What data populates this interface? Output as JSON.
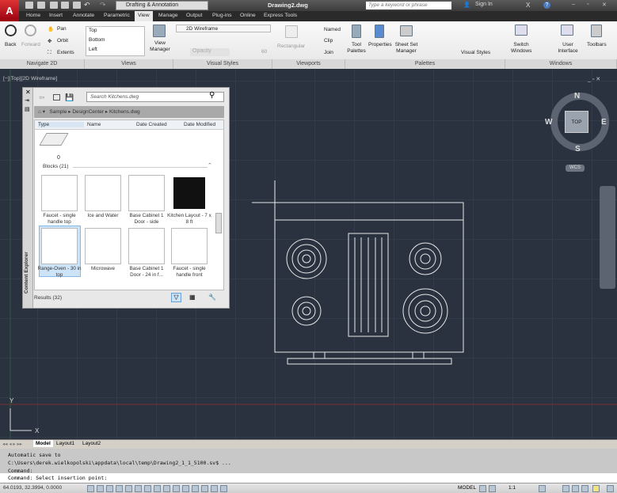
{
  "title": {
    "workspace": "Drafting & Annotation",
    "document": "Drawing2.dwg",
    "search_placeholder": "Type a keyword or phrase",
    "sign_in": "Sign In"
  },
  "tabs": [
    "Home",
    "Insert",
    "Annotate",
    "Parametric",
    "View",
    "Manage",
    "Output",
    "Plug-ins",
    "Online",
    "Express Tools"
  ],
  "active_tab": "View",
  "ribbon": {
    "navigate": {
      "back": "Back",
      "forward": "Forward",
      "pan": "Pan",
      "orbit": "Orbit",
      "extents": "Extents",
      "title": "Navigate 2D"
    },
    "views": {
      "items": [
        "Top",
        "Bottom",
        "Left"
      ],
      "manager": "View Manager",
      "title": "Views"
    },
    "visual_styles": {
      "current": "2D Wireframe",
      "opacity_label": "Opacity",
      "opacity_value": "60",
      "title": "Visual Styles"
    },
    "viewports": {
      "rectangular": "Rectangular",
      "named": "Named",
      "clip": "Clip",
      "join": "Join",
      "title": "Viewports"
    },
    "palettes": {
      "tool_palettes": "Tool Palettes",
      "properties": "Properties",
      "sheet_set": "Sheet Set Manager",
      "visual_styles": "Visual Styles",
      "title": "Palettes"
    },
    "windows": {
      "switch": "Switch Windows",
      "ui": "User Interface",
      "toolbars": "Toolbars",
      "title": "Windows"
    }
  },
  "viewport": {
    "label": "[−][Top][2D Wireframe]",
    "viewcube": {
      "top": "TOP",
      "n": "N",
      "s": "S",
      "e": "E",
      "w": "W",
      "wcs": "WCS"
    },
    "ucs_y": "Y",
    "ucs_x": "X"
  },
  "palette": {
    "search_placeholder": "Search Kitchens.dwg",
    "breadcrumb": [
      "Sample",
      "DesignCenter",
      "Kitchens.dwg"
    ],
    "columns": [
      "Type",
      "Name",
      "Date Created",
      "Date Modified"
    ],
    "layer_count": "0",
    "group": "Blocks (21)",
    "blocks": [
      "Faucet - single handle top",
      "Ice and Water",
      "Base Cabinet 1 Door - side",
      "Kitchen Layout - 7 x 8 ft",
      "Range-Oven - 30 in top",
      "Microwave",
      "Base Cabinet 1 Door - 24 in f...",
      "Faucet - single handle front"
    ],
    "selected": "Range-Oven - 30 in top",
    "results": "Results (32)",
    "side_title": "Content Explorer"
  },
  "layout_tabs": [
    "Model",
    "Layout1",
    "Layout2"
  ],
  "command": {
    "history": [
      "Automatic save to",
      "C:\\Users\\derek.wielkopolski\\appdata\\local\\temp\\Drawing2_1_1_5100.sv$ ...",
      "Command:"
    ],
    "current": "Command: Select insertion point:"
  },
  "status": {
    "coords": "64.0193, 32.3994, 0.0000",
    "space": "MODEL",
    "scale": "1:1"
  }
}
